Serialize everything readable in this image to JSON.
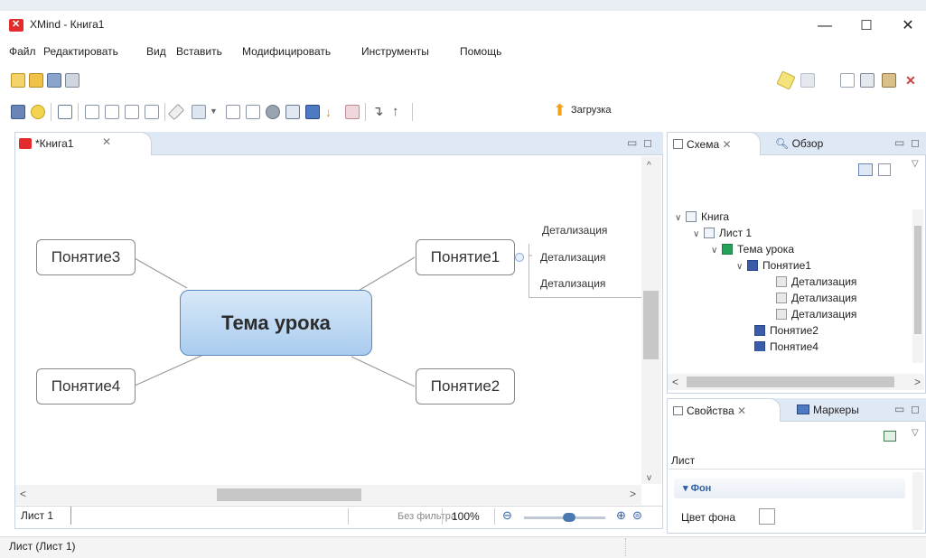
{
  "window": {
    "title": "XMind - Книга1",
    "minimize": "—",
    "maximize": "☐",
    "close": "✕"
  },
  "menu": [
    "Файл",
    "Редактировать",
    "Вид",
    "Вставить",
    "Модифицировать",
    "Инструменты",
    "Помощь"
  ],
  "toolbar": {
    "upload_label": "Загрузка"
  },
  "editor": {
    "tab_label": "*Книга1",
    "tab_close": "✕",
    "central_topic": "Тема урока",
    "topics": [
      "Понятие1",
      "Понятие2",
      "Понятие3",
      "Понятие4"
    ],
    "details": [
      "Детализация",
      "Детализация",
      "Детализация"
    ],
    "sheet_tab": "Лист 1",
    "filter_label": "Без фильтра",
    "zoom": "100%",
    "zoom_level": 0.55
  },
  "outline_panel": {
    "tabs": [
      "Схема",
      "Обзор"
    ],
    "tree": [
      {
        "label": "Книга",
        "icon": "workbook-icon",
        "arrow": "∨"
      },
      {
        "label": "Лист 1",
        "icon": "sheet-icon",
        "arrow": "∨"
      },
      {
        "label": "Тема урока",
        "icon": "central-topic-icon",
        "arrow": "∨"
      },
      {
        "label": "Понятие1",
        "icon": "main-topic-icon",
        "arrow": "∨"
      },
      {
        "label": "Детализация",
        "icon": "subtopic-icon",
        "arrow": ""
      },
      {
        "label": "Детализация",
        "icon": "subtopic-icon",
        "arrow": ""
      },
      {
        "label": "Детализация",
        "icon": "subtopic-icon",
        "arrow": ""
      },
      {
        "label": "Понятие2",
        "icon": "main-topic-icon",
        "arrow": ""
      },
      {
        "label": "Понятие4",
        "icon": "main-topic-icon",
        "arrow": ""
      }
    ]
  },
  "properties_panel": {
    "tabs": [
      "Свойства",
      "Маркеры"
    ],
    "header": "Лист",
    "section": "Фон",
    "bg_color_label": "Цвет фона"
  },
  "status": {
    "text": "Лист (Лист 1)"
  }
}
